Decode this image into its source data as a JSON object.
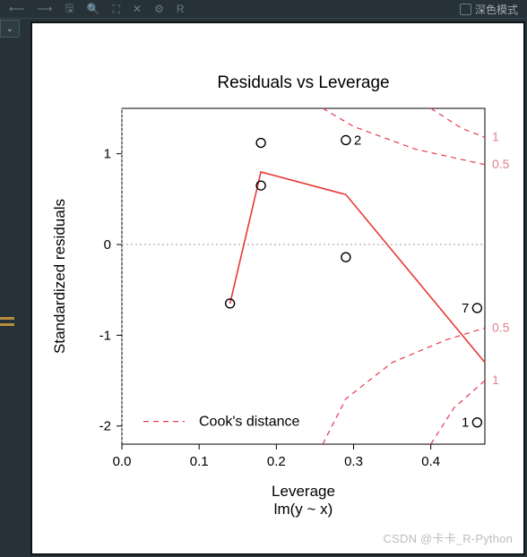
{
  "toolbar": {
    "icons": [
      "back",
      "forward",
      "save",
      "zoom",
      "export",
      "close",
      "settings",
      "lang"
    ],
    "lang_label": "R",
    "dark_mode_label": "深色模式"
  },
  "dropdown_icon": "⌄",
  "watermark": "CSDN @卡卡_R-Python",
  "chart_data": {
    "type": "scatter",
    "title": "Residuals vs Leverage",
    "xlabel": "Leverage",
    "sublabel": "lm(y ~ x)",
    "ylabel": "Standardized residuals",
    "xlim": [
      0.0,
      0.47
    ],
    "ylim": [
      -2.2,
      1.5
    ],
    "xticks": [
      0.0,
      0.1,
      0.2,
      0.3,
      0.4
    ],
    "yticks": [
      -2,
      -1,
      0,
      1
    ],
    "points": [
      {
        "x": 0.14,
        "y": -0.65
      },
      {
        "x": 0.18,
        "y": 0.65
      },
      {
        "x": 0.18,
        "y": 1.12
      },
      {
        "x": 0.29,
        "y": 1.15,
        "label": "2"
      },
      {
        "x": 0.29,
        "y": -0.14
      },
      {
        "x": 0.46,
        "y": -0.7,
        "label": "7"
      },
      {
        "x": 0.46,
        "y": -1.96,
        "label": "1"
      }
    ],
    "loess_line": [
      {
        "x": 0.14,
        "y": -0.65
      },
      {
        "x": 0.18,
        "y": 0.8
      },
      {
        "x": 0.29,
        "y": 0.55
      },
      {
        "x": 0.47,
        "y": -1.3
      }
    ],
    "cook_contours": {
      "levels": [
        0.5,
        1
      ],
      "upper_0_5": [
        {
          "x": 0.26,
          "y": 1.5
        },
        {
          "x": 0.3,
          "y": 1.3
        },
        {
          "x": 0.38,
          "y": 1.05
        },
        {
          "x": 0.47,
          "y": 0.88
        }
      ],
      "upper_1": [
        {
          "x": 0.4,
          "y": 1.5
        },
        {
          "x": 0.44,
          "y": 1.28
        },
        {
          "x": 0.47,
          "y": 1.18
        }
      ],
      "lower_0_5": [
        {
          "x": 0.26,
          "y": -2.2
        },
        {
          "x": 0.29,
          "y": -1.7
        },
        {
          "x": 0.35,
          "y": -1.3
        },
        {
          "x": 0.42,
          "y": -1.05
        },
        {
          "x": 0.47,
          "y": -0.92
        }
      ],
      "lower_1": [
        {
          "x": 0.4,
          "y": -2.2
        },
        {
          "x": 0.43,
          "y": -1.8
        },
        {
          "x": 0.47,
          "y": -1.5
        }
      ]
    },
    "legend": {
      "label": "Cook's distance"
    }
  }
}
